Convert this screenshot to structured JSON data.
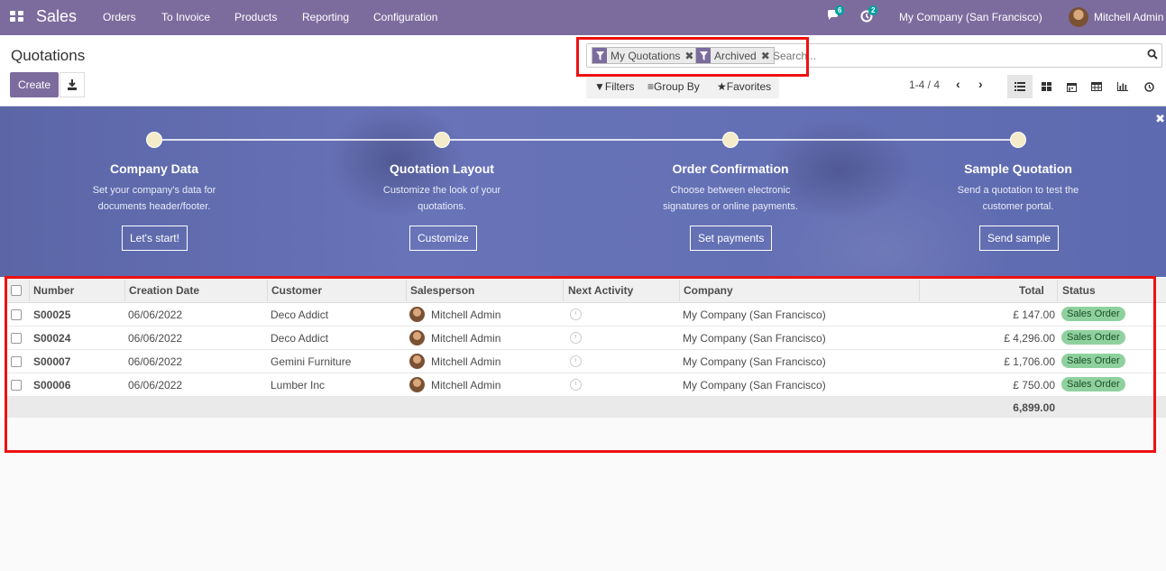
{
  "navbar": {
    "brand": "Sales",
    "menu": [
      "Orders",
      "To Invoice",
      "Products",
      "Reporting",
      "Configuration"
    ],
    "messages_count": "6",
    "activities_count": "2",
    "company": "My Company (San Francisco)",
    "user": "Mitchell Admin"
  },
  "control": {
    "title": "Quotations",
    "create_label": "Create",
    "facets": [
      "My Quotations",
      "Archived"
    ],
    "search_placeholder": "Search...",
    "filters_label": "Filters",
    "groupby_label": "Group By",
    "favorites_label": "Favorites",
    "pager": "1-4 / 4"
  },
  "banner": {
    "steps": [
      {
        "title": "Company Data",
        "desc1": "Set your company's data for",
        "desc2": "documents header/footer.",
        "button": "Let's start!"
      },
      {
        "title": "Quotation Layout",
        "desc1": "Customize the look of your",
        "desc2": "quotations.",
        "button": "Customize"
      },
      {
        "title": "Order Confirmation",
        "desc1": "Choose between electronic",
        "desc2": "signatures or online payments.",
        "button": "Set payments"
      },
      {
        "title": "Sample Quotation",
        "desc1": "Send a quotation to test the",
        "desc2": "customer portal.",
        "button": "Send sample"
      }
    ]
  },
  "table": {
    "headers": {
      "number": "Number",
      "creation_date": "Creation Date",
      "customer": "Customer",
      "salesperson": "Salesperson",
      "next_activity": "Next Activity",
      "company": "Company",
      "total": "Total",
      "status": "Status"
    },
    "rows": [
      {
        "number": "S00025",
        "date": "06/06/2022",
        "customer": "Deco Addict",
        "salesperson": "Mitchell Admin",
        "company": "My Company (San Francisco)",
        "total": "£ 147.00",
        "status": "Sales Order"
      },
      {
        "number": "S00024",
        "date": "06/06/2022",
        "customer": "Deco Addict",
        "salesperson": "Mitchell Admin",
        "company": "My Company (San Francisco)",
        "total": "£ 4,296.00",
        "status": "Sales Order"
      },
      {
        "number": "S00007",
        "date": "06/06/2022",
        "customer": "Gemini Furniture",
        "salesperson": "Mitchell Admin",
        "company": "My Company (San Francisco)",
        "total": "£ 1,706.00",
        "status": "Sales Order"
      },
      {
        "number": "S00006",
        "date": "06/06/2022",
        "customer": "Lumber Inc",
        "salesperson": "Mitchell Admin",
        "company": "My Company (San Francisco)",
        "total": "£ 750.00",
        "status": "Sales Order"
      }
    ],
    "sum_total": "6,899.00"
  },
  "colors": {
    "brand": "#7c6c9e",
    "status_badge": "#8fd19e",
    "highlight": "#ee1111"
  }
}
